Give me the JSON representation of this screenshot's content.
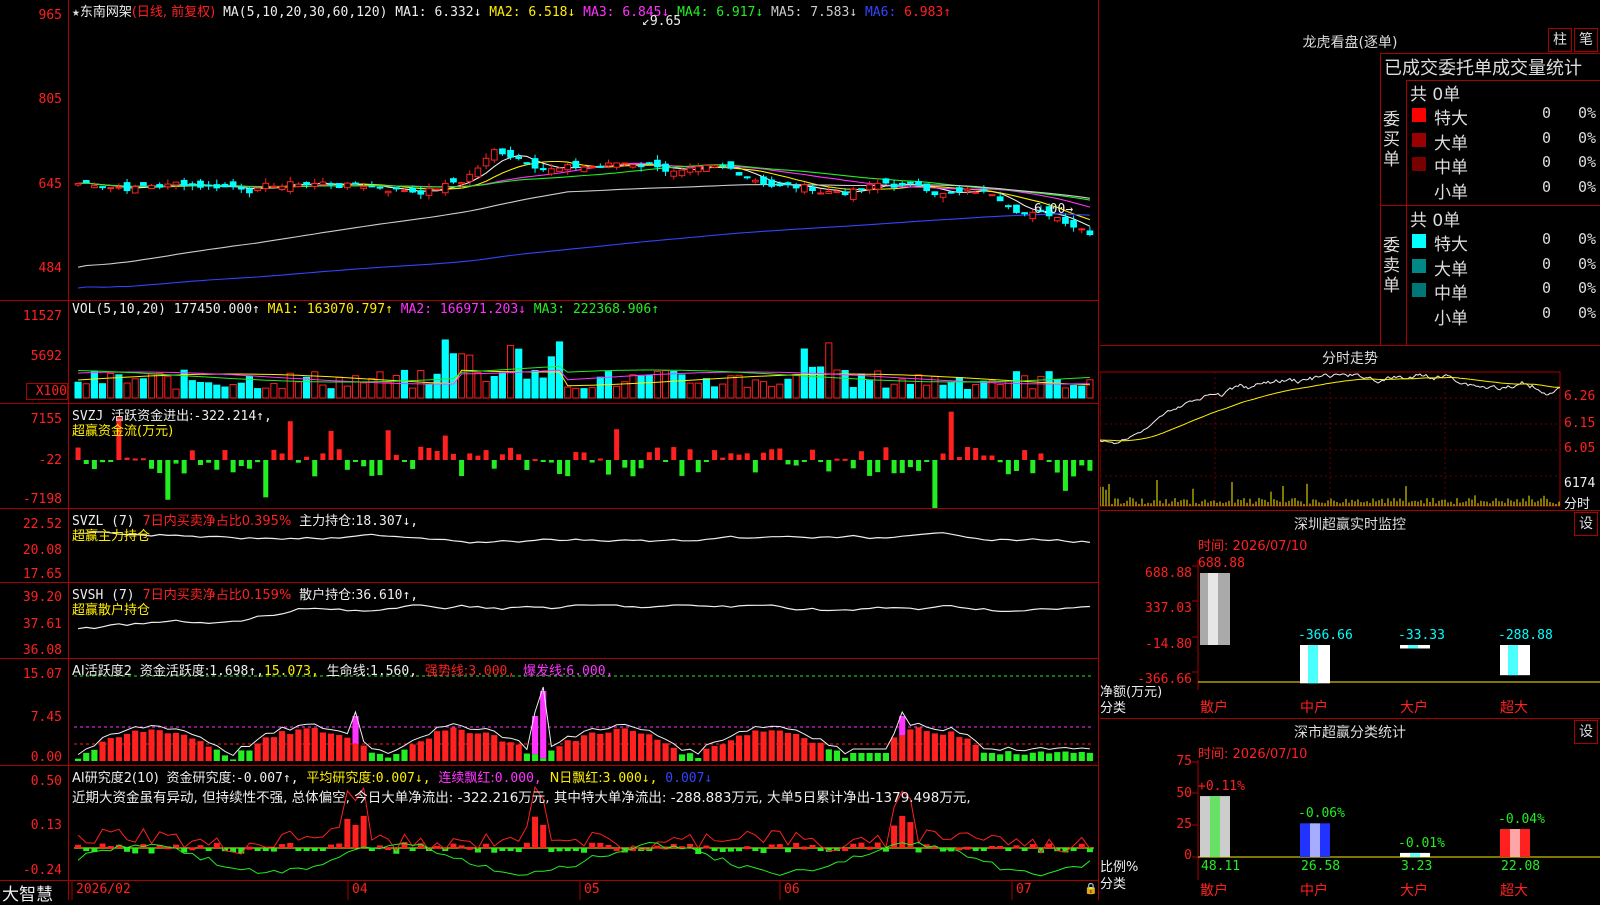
{
  "stock": {
    "name": "东南网架",
    "mode": "(日线, 前复权)",
    "ma_params": "MA(5,10,20,30,60,120)",
    "ma": [
      {
        "label": "MA1:",
        "value": "6.332↓",
        "color": "#eeeeee"
      },
      {
        "label": "MA2:",
        "value": "6.518↓",
        "color": "#ffee00"
      },
      {
        "label": "MA3:",
        "value": "6.845↓",
        "color": "#ff33ff"
      },
      {
        "label": "MA4:",
        "value": "6.917↓",
        "color": "#22ee22"
      },
      {
        "label": "MA5:",
        "value": "7.583↓",
        "color": "#cccccc"
      },
      {
        "label": "MA6:",
        "value": "6.983↑",
        "color": "#3344ff"
      }
    ],
    "high_mark": "9.65",
    "low_mark": "6.00",
    "price_axis": [
      "965",
      "805",
      "645",
      "484"
    ]
  },
  "vol": {
    "params": "VOL(5,10,20)",
    "value": "177450.000↑",
    "ma": [
      {
        "label": "MA1:",
        "value": "163070.797↑",
        "color": "#ffee00"
      },
      {
        "label": "MA2:",
        "value": "166971.203↓",
        "color": "#ff33ff"
      },
      {
        "label": "MA3:",
        "value": "222368.906↑",
        "color": "#22ee22"
      }
    ],
    "axis": [
      "11527",
      "5692",
      "X100"
    ]
  },
  "svzj": {
    "title": "SVZJ",
    "label": "活跃资金进出:",
    "value": "-322.214↑,",
    "sub": "超赢资金流(万元)",
    "axis": [
      "7155",
      "-22",
      "-7198"
    ]
  },
  "svzl": {
    "title": "SVZL (7)",
    "label1": "7日内买卖净占比0.395%",
    "label2": "主力持仓:",
    "value": "18.307↓,",
    "sub": "超赢主力持仓",
    "axis": [
      "22.52",
      "20.08",
      "17.65"
    ]
  },
  "svsh": {
    "title": "SVSH (7)",
    "label1": "7日内买卖净占比0.159%",
    "label2": "散户持仓:",
    "value": "36.610↑,",
    "sub": "超赢散户持仓",
    "axis": [
      "39.20",
      "37.61",
      "36.08"
    ]
  },
  "ai1": {
    "title": "AI活跃度2",
    "label": "资金活跃度:",
    "v1": "1.698↑,",
    "v2": "15.073,",
    "l3": "生命线:",
    "v3": "1.560,",
    "l4": "强势线:",
    "v4": "3.000,",
    "l5": "爆发线:",
    "v5": "6.000,",
    "axis": [
      "15.07",
      "7.45",
      "0.00"
    ]
  },
  "ai2": {
    "title": "AI研究度2(10)",
    "label": "资金研究度:",
    "v1": "-0.007↑,",
    "l2": "平均研究度:",
    "v2": "0.007↓,",
    "l3": "连续飘红:",
    "v3": "0.000,",
    "l4": "N日飘红:",
    "v4": "3.000↓,",
    "v5": "0.007↓",
    "comment": "近期大资金虽有异动, 但持续性不强, 总体偏空, 今日大单净流出: -322.216万元, 其中特大单净流出: -288.883万元, 大单5日累计净出-1379.498万元,",
    "axis": [
      "0.50",
      "0.13",
      "-0.24"
    ]
  },
  "bottom": {
    "brand": "大智慧",
    "dates": [
      "2026/02",
      "04",
      "05",
      "06",
      "07"
    ]
  },
  "right": {
    "lhb_title": "龙虎看盘(逐单)",
    "btn_bar": "柱",
    "btn_pen": "笔",
    "tabs": "已成交委托单成交量统计",
    "buy_label": "委买单",
    "sell_label": "委卖单",
    "buy_total": "共 0单",
    "sell_total": "共 0单",
    "buy_rows": [
      {
        "name": "特大",
        "count": "0",
        "pct": "0%",
        "color": "#ff0000"
      },
      {
        "name": "大单",
        "count": "0",
        "pct": "0%",
        "color": "#990000"
      },
      {
        "name": "中单",
        "count": "0",
        "pct": "0%",
        "color": "#770000"
      },
      {
        "name": "小单",
        "count": "0",
        "pct": "0%",
        "color": "#000000"
      }
    ],
    "sell_rows": [
      {
        "name": "特大",
        "count": "0",
        "pct": "0%",
        "color": "#00ffff"
      },
      {
        "name": "大单",
        "count": "0",
        "pct": "0%",
        "color": "#008888"
      },
      {
        "name": "中单",
        "count": "0",
        "pct": "0%",
        "color": "#007777"
      },
      {
        "name": "小单",
        "count": "0",
        "pct": "0%",
        "color": "#000000"
      }
    ],
    "intraday_title": "分时走势",
    "intraday_axis": [
      "6.26",
      "6.15",
      "6.05"
    ],
    "intraday_vol": "6174",
    "intraday_vol_unit": "分时",
    "monitor_title": "深圳超赢实时监控",
    "settings": "设",
    "monitor_time": "时间: 2026/07/10",
    "monitor_axis": [
      "688.88",
      "337.03",
      "-14.80",
      "-366.66"
    ],
    "monitor_unit": "净额(万元)",
    "monitor_unit2": "分类",
    "monitor_bars": [
      {
        "name": "散户",
        "value": "688.88"
      },
      {
        "name": "中户",
        "value": "-366.66"
      },
      {
        "name": "大户",
        "value": "-33.33"
      },
      {
        "name": "超大",
        "value": "-288.88"
      }
    ],
    "class_title": "深市超赢分类统计",
    "class_time": "时间: 2026/07/10",
    "class_axis": [
      "75",
      "50",
      "25",
      "0"
    ],
    "class_unit": "比例%",
    "class_unit2": "分类",
    "class_bars": [
      {
        "name": "散户",
        "top": "+0.11%",
        "value": "48.11"
      },
      {
        "name": "中户",
        "top": "-0.06%",
        "value": "26.58"
      },
      {
        "name": "大户",
        "top": "-0.01%",
        "value": "3.23"
      },
      {
        "name": "超大",
        "top": "-0.04%",
        "value": "22.08"
      }
    ]
  }
}
